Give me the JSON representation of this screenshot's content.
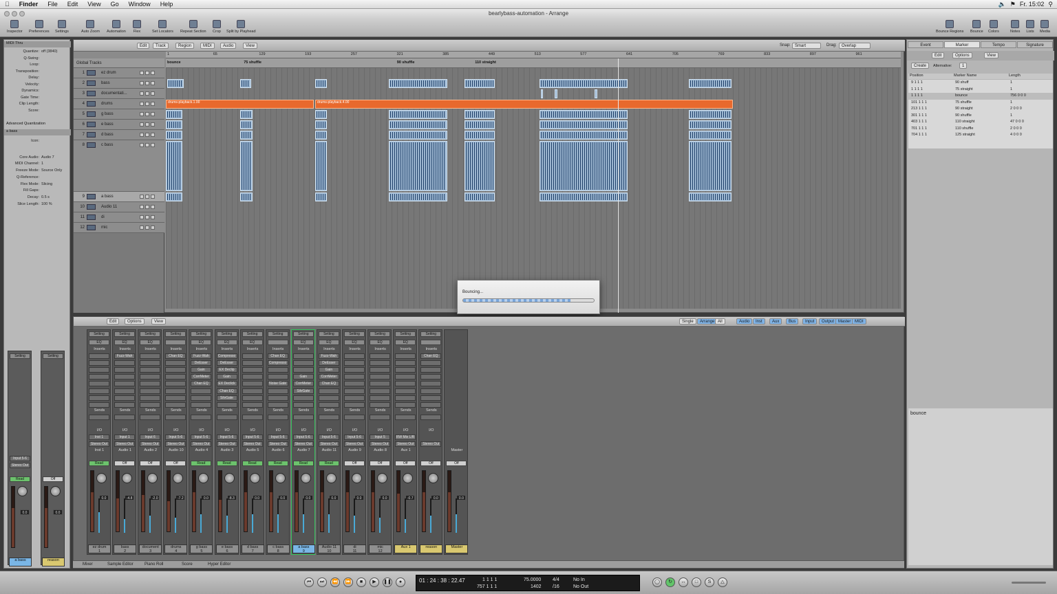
{
  "menubar": {
    "apple": "",
    "app": "Finder",
    "items": [
      "File",
      "Edit",
      "View",
      "Go",
      "Window",
      "Help"
    ],
    "clock": "Fr. 15:02"
  },
  "window": {
    "title": "bearlybass-automation - Arrange"
  },
  "toolbar": {
    "left": [
      {
        "label": "Inspector"
      },
      {
        "label": "Preferences"
      },
      {
        "label": "Settings"
      },
      {
        "label": "Auto Zoom"
      },
      {
        "label": "Automation"
      },
      {
        "label": "Flex"
      },
      {
        "label": "Set Locators"
      },
      {
        "label": "Repeat Section"
      },
      {
        "label": "Crop"
      },
      {
        "label": "Split by Playhead"
      }
    ],
    "right": [
      {
        "label": "Bounce Regions"
      },
      {
        "label": "Bounce"
      },
      {
        "label": "Colors"
      },
      {
        "label": "Notes"
      },
      {
        "label": "Lists"
      },
      {
        "label": "Media"
      }
    ]
  },
  "inspector": {
    "header": "MIDI Thru",
    "rows": [
      {
        "label": "Quantize:",
        "value": "off (3840)"
      },
      {
        "label": "Q-Swing:",
        "value": ""
      },
      {
        "label": "Loop:",
        "value": ""
      },
      {
        "label": "Transposition:",
        "value": ""
      },
      {
        "label": "Delay:",
        "value": ""
      },
      {
        "label": "Velocity:",
        "value": ""
      },
      {
        "label": "Dynamics:",
        "value": ""
      },
      {
        "label": "Gate Time:",
        "value": ""
      },
      {
        "label": "Clip Length:",
        "value": ""
      },
      {
        "label": "Score:",
        "value": ""
      }
    ],
    "adv": "Advanced Quantization",
    "track_header": "a bass",
    "track_rows": [
      {
        "label": "Icon:",
        "value": ""
      },
      {
        "label": "Core Audio:",
        "value": "Audio 7"
      },
      {
        "label": "MIDI Channel:",
        "value": "1"
      },
      {
        "label": "Freeze Mode:",
        "value": "Source Only"
      },
      {
        "label": "Q-Reference:",
        "value": ""
      },
      {
        "label": "Flex Mode:",
        "value": "Slicing"
      },
      {
        "label": "Fill Gaps:",
        "value": ""
      },
      {
        "label": "Decay:",
        "value": "0.5 s"
      },
      {
        "label": "Slice Length:",
        "value": "100 %"
      }
    ]
  },
  "arrange": {
    "menus": [
      "Edit",
      "Track",
      "Region",
      "MIDI",
      "Audio",
      "View"
    ],
    "snap_label": "Snap:",
    "snap": "Smart",
    "drag_label": "Drag:",
    "drag": "Overlap",
    "global": "Global Tracks",
    "ruler": [
      "1",
      "65",
      "129",
      "193",
      "257",
      "321",
      "385",
      "449",
      "513",
      "577",
      "641",
      "705",
      "769",
      "833",
      "897",
      "961"
    ],
    "markers": [
      {
        "name": "bounce",
        "bar": 1
      },
      {
        "name": "75 shuffle",
        "bar": 101
      },
      {
        "name": "90 shuffle",
        "bar": 301
      },
      {
        "name": "110 straight",
        "bar": 403
      }
    ],
    "tracks": [
      {
        "n": "1",
        "name": "ez drum"
      },
      {
        "n": "2",
        "name": "bass"
      },
      {
        "n": "3",
        "name": "documentati..."
      },
      {
        "n": "4",
        "name": "drums"
      },
      {
        "n": "5",
        "name": "g bass"
      },
      {
        "n": "6",
        "name": "e bass"
      },
      {
        "n": "7",
        "name": "d bass"
      },
      {
        "n": "8",
        "name": "c bass"
      },
      {
        "n": "9",
        "name": "a bass"
      },
      {
        "n": "10",
        "name": "Audio 11"
      },
      {
        "n": "11",
        "name": "di"
      },
      {
        "n": "12",
        "name": "mic"
      }
    ],
    "drum_regions": [
      "drums-playback.1.00",
      "drums-playback.4.00"
    ]
  },
  "bounce_dialog": {
    "title": "Bouncing...",
    "progress": 0.82
  },
  "mixer": {
    "menus": [
      "Edit",
      "Options",
      "View"
    ],
    "modes": [
      "Single",
      "Arrange",
      "All"
    ],
    "filters": [
      "Audio",
      "Inst",
      "Aux",
      "Bus",
      "Input",
      "Output",
      "Master",
      "MIDI"
    ],
    "strips": [
      {
        "name": "ez drum",
        "num": "1",
        "io_in": "Inst 1",
        "out": "Stereo Out",
        "ch": "Inst 1",
        "mode": "Read",
        "vol": "0.0",
        "inserts": [],
        "fader": 0.65,
        "meter": 0.6
      },
      {
        "name": "bass",
        "num": "2",
        "io_in": "Input 1",
        "out": "Stereo Out",
        "ch": "Audio 1",
        "mode": "Off",
        "vol": "-4.8",
        "inserts": [
          "Fuzz-Wah"
        ],
        "fader": 0.55,
        "meter": 0.4
      },
      {
        "name": "document",
        "num": "3",
        "io_in": "Input 6",
        "out": "Stereo Out",
        "ch": "Audio 2",
        "mode": "Off",
        "vol": "-2.0",
        "inserts": [],
        "fader": 0.6,
        "meter": 0.5
      },
      {
        "name": "drums",
        "num": "4",
        "io_in": "Input 5-6",
        "out": "Stereo Out",
        "ch": "Audio 10",
        "mode": "Off",
        "vol": "-7.2",
        "inserts": [
          "Chan EQ"
        ],
        "fader": 0.5,
        "meter": 0.45
      },
      {
        "name": "g bass",
        "num": "5",
        "io_in": "Input 5-6",
        "out": "Stereo Out",
        "ch": "Audio 4",
        "mode": "Read",
        "vol": "0.0",
        "inserts": [
          "Fuzz-Wah",
          "DeEsser",
          "Gain",
          "CorrMeter",
          "Chan EQ"
        ],
        "fader": 0.65,
        "meter": 0.55
      },
      {
        "name": "e bass",
        "num": "6",
        "io_in": "Input 5-6",
        "out": "Stereo Out",
        "ch": "Audio 3",
        "mode": "Read",
        "vol": "-8.3",
        "inserts": [
          "Compresso",
          "DeEsser",
          "EX Declip",
          "Gain",
          "EX Declick",
          "Chan EQ",
          "SilvGate"
        ],
        "fader": 0.52,
        "meter": 0.5
      },
      {
        "name": "d bass",
        "num": "7",
        "io_in": "Input 5-6",
        "out": "Stereo Out",
        "ch": "Audio 5",
        "mode": "Read",
        "vol": "0.0",
        "inserts": [],
        "fader": 0.65,
        "meter": 0.55
      },
      {
        "name": "c bass",
        "num": "8",
        "io_in": "Input 5-6",
        "out": "Stereo Out",
        "ch": "Audio 6",
        "mode": "Read",
        "vol": "0.0",
        "inserts": [
          "Chan EQ",
          "Compresso",
          "",
          "",
          "Noise Gate"
        ],
        "fader": 0.65,
        "meter": 0.55
      },
      {
        "name": "a bass",
        "num": "9",
        "io_in": "Input 5-6",
        "out": "Stereo Out",
        "ch": "Audio 7",
        "mode": "Read",
        "vol": "0.0",
        "inserts": [
          "",
          "",
          "",
          "Gain",
          "CorrMeter",
          "SilvGate"
        ],
        "fader": 0.65,
        "meter": 0.55
      },
      {
        "name": "Audio 11",
        "num": "10",
        "io_in": "Input 5-6",
        "out": "Stereo Out",
        "ch": "Audio 11",
        "mode": "Read",
        "vol": "0.0",
        "inserts": [
          "Fuzz-Wah",
          "DeEsser",
          "Gain",
          "CorrMeter",
          "Chan EQ"
        ],
        "fader": 0.65,
        "meter": 0.55
      },
      {
        "name": "di",
        "num": "11",
        "io_in": "Input 5-6",
        "out": "Stereo Out",
        "ch": "Audio 9",
        "mode": "Off",
        "vol": "0.0",
        "inserts": [],
        "fader": 0.65,
        "meter": 0.5
      },
      {
        "name": "mic",
        "num": "12",
        "io_in": "Input 5",
        "out": "Stereo Out",
        "ch": "Audio 8",
        "mode": "Off",
        "vol": "0.0",
        "inserts": [],
        "fader": 0.65,
        "meter": 0.45
      },
      {
        "name": "Aux 1",
        "num": "",
        "io_in": "RW Mix L/R",
        "out": "Stereo Out",
        "ch": "Aux 1",
        "mode": "Off",
        "vol": "-0.7",
        "inserts": [],
        "fader": 0.63,
        "meter": 0.4
      },
      {
        "name": "reason",
        "num": "",
        "io_in": "",
        "out": "Stereo Out",
        "ch": "",
        "mode": "Off",
        "vol": "0.0",
        "inserts": [
          "Chan EQ"
        ],
        "fader": 0.65,
        "meter": 0.5
      },
      {
        "name": "Master",
        "num": "",
        "io_in": "",
        "out": "",
        "ch": "Master",
        "mode": "Off",
        "vol": "0.0",
        "inserts": [],
        "fader": 0.65,
        "meter": 0.55
      }
    ],
    "inspector_strips": [
      {
        "name": "a bass",
        "mode": "Read",
        "in": "Input 5-6",
        "out": "Stereo Out",
        "vol": "0.0"
      },
      {
        "name": "reason",
        "mode": "Off",
        "vol": "0.0"
      }
    ]
  },
  "right": {
    "tabs": [
      "Event",
      "Marker",
      "Tempo",
      "Signature"
    ],
    "active": "Marker",
    "edit": "Edit",
    "options": "Options",
    "view": "View",
    "create": "Create",
    "alt_label": "Alternative:",
    "alt": "1",
    "cols": [
      "Position",
      "Marker Name",
      "Length"
    ],
    "markers": [
      {
        "pos": "9 1 1 1",
        "name": "90 shuff",
        "len": "1"
      },
      {
        "pos": "1 1 1 1",
        "name": "75 straight",
        "len": "1"
      },
      {
        "pos": "1 1 1 1",
        "name": "bounce",
        "len": "756 0 0 0"
      },
      {
        "pos": "101 1 1 1",
        "name": "75 shuffle",
        "len": "1"
      },
      {
        "pos": "213 1 1 1",
        "name": "90 straight",
        "len": "2 0 0 0"
      },
      {
        "pos": "301 1 1 1",
        "name": "90 shuffle",
        "len": "1"
      },
      {
        "pos": "403 1 1 1",
        "name": "110 straight",
        "len": "47 0 0 0"
      },
      {
        "pos": "701 1 1 1",
        "name": "110 shuffle",
        "len": "2 0 0 0"
      },
      {
        "pos": "704 1 1 1",
        "name": "125 straight",
        "len": "4 0 0 0"
      }
    ],
    "note": "bounce"
  },
  "lowbar": [
    "Mixer",
    "Sample Editor",
    "Piano Roll",
    "Score",
    "Hyper Editor"
  ],
  "transport": {
    "smpte": "01 : 24 : 38 : 22.47",
    "bars": "1   1   1   1",
    "pos2": "757   1   1   1",
    "tempo": "75.0000",
    "sig": "4/4",
    "div": "/16",
    "bpm2": "1402",
    "in": "No In",
    "out": "No Out"
  }
}
